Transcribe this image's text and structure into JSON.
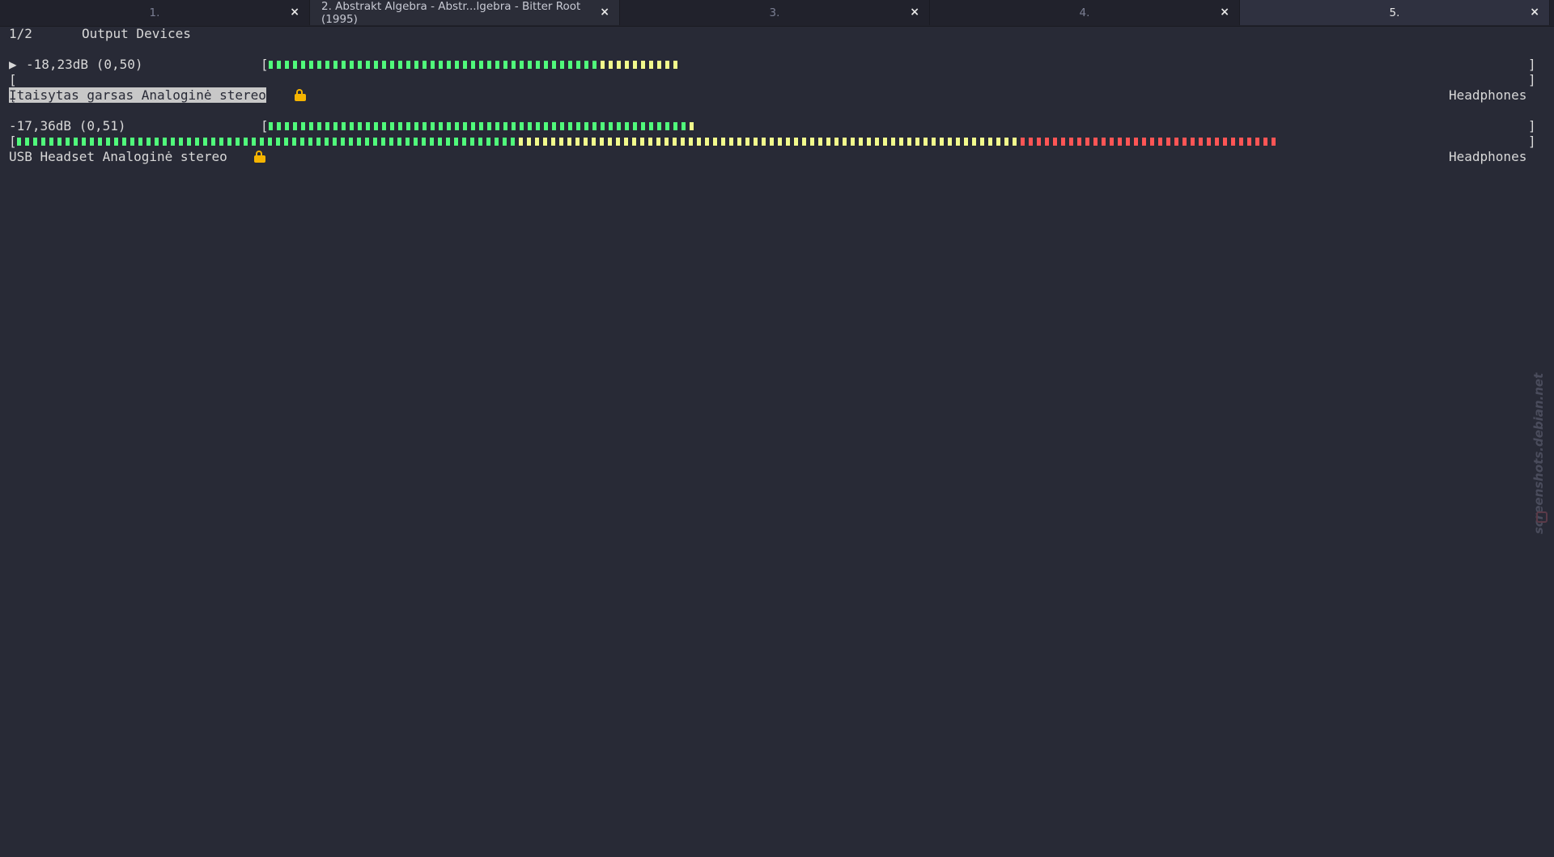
{
  "tabs": [
    {
      "label": "1.",
      "close": "×"
    },
    {
      "label": "2. Abstrakt Algebra - Abstr...lgebra - Bitter Root (1995)",
      "close": "×"
    },
    {
      "label": "3.",
      "close": "×"
    },
    {
      "label": "4.",
      "close": "×"
    },
    {
      "label": "5.",
      "close": "×"
    }
  ],
  "header": {
    "page": "1/2",
    "title": "Output Devices"
  },
  "devices": [
    {
      "marker": "▶",
      "volume": "-18,23dB (0,50)",
      "name": "Įtaisytas garsas Analoginė stereo",
      "port": "Headphones",
      "selected": true,
      "volume_bar_fraction": 0.5,
      "peak_bar_fraction": 0
    },
    {
      "marker": "",
      "volume": "-17,36dB (0,51)",
      "name": "USB Headset Analoginė stereo",
      "port": "Headphones",
      "selected": false,
      "volume_bar_fraction": 0.51,
      "peak_bar_fraction": 1.0
    }
  ],
  "brackets": {
    "open": "[",
    "close": "]"
  },
  "colors": {
    "low": "#50fa7b",
    "mid": "#f1fa8c",
    "high": "#ff5555",
    "lock": "#f5b400"
  },
  "watermark": "screenshots.debian.net"
}
